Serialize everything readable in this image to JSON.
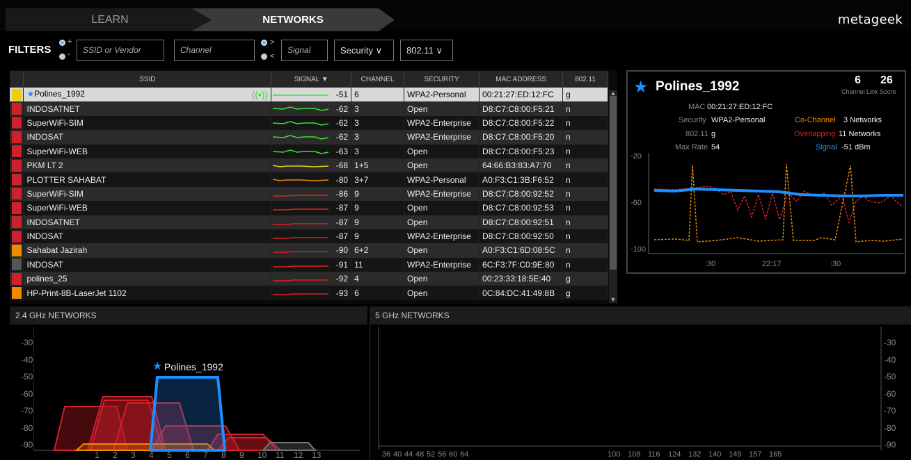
{
  "nav": {
    "learn": "LEARN",
    "networks": "NETWORKS",
    "brand": "metageek"
  },
  "filters": {
    "label": "FILTERS",
    "plus": "+",
    "minus": "-",
    "gt": ">",
    "lt": "<",
    "ssid_placeholder": "SSID or Vendor",
    "channel_placeholder": "Channel",
    "signal_placeholder": "Signal",
    "security": "Security ∨",
    "standard": "802.11 ∨"
  },
  "table": {
    "headers": [
      "SSID",
      "SIGNAL ▼",
      "CHANNEL",
      "SECURITY",
      "MAC ADDRESS",
      "802.11"
    ],
    "rows": [
      {
        "color": "#f0d000",
        "ssid": "Polines_1992",
        "signal": "-51",
        "channel": "6",
        "security": "WPA2-Personal",
        "mac": "00:21:27:ED:12:FC",
        "std": "g",
        "sigcolor": "#32e632"
      },
      {
        "color": "#d0202a",
        "ssid": "INDOSATNET",
        "signal": "-62",
        "channel": "3",
        "security": "Open",
        "mac": "D8:C7:C8:00:F5:21",
        "std": "n",
        "sigcolor": "#32e632"
      },
      {
        "color": "#d0202a",
        "ssid": "SuperWiFi-SIM",
        "signal": "-62",
        "channel": "3",
        "security": "WPA2-Enterprise",
        "mac": "D8:C7:C8:00:F5:22",
        "std": "n",
        "sigcolor": "#32e632"
      },
      {
        "color": "#d0202a",
        "ssid": "INDOSAT",
        "signal": "-62",
        "channel": "3",
        "security": "WPA2-Enterprise",
        "mac": "D8:C7:C8:00:F5:20",
        "std": "n",
        "sigcolor": "#32e632"
      },
      {
        "color": "#d0202a",
        "ssid": "SuperWiFi-WEB",
        "signal": "-63",
        "channel": "3",
        "security": "Open",
        "mac": "D8:C7:C8:00:F5:23",
        "std": "n",
        "sigcolor": "#32e632"
      },
      {
        "color": "#d0202a",
        "ssid": "PKM LT 2",
        "signal": "-68",
        "channel": "1+5",
        "security": "Open",
        "mac": "64:66:B3:83:A7:70",
        "std": "n",
        "sigcolor": "#e6d020"
      },
      {
        "color": "#d0202a",
        "ssid": "PLOTTER SAHABAT",
        "signal": "-80",
        "channel": "3+7",
        "security": "WPA2-Personal",
        "mac": "A0:F3:C1:3B:F6:52",
        "std": "n",
        "sigcolor": "#e68a10"
      },
      {
        "color": "#d0202a",
        "ssid": "SuperWiFi-SIM",
        "signal": "-86",
        "channel": "9",
        "security": "WPA2-Enterprise",
        "mac": "D8:C7:C8:00:92:52",
        "std": "n",
        "sigcolor": "#e02020"
      },
      {
        "color": "#d0202a",
        "ssid": "SuperWiFi-WEB",
        "signal": "-87",
        "channel": "9",
        "security": "Open",
        "mac": "D8:C7:C8:00:92:53",
        "std": "n",
        "sigcolor": "#e02020"
      },
      {
        "color": "#d0202a",
        "ssid": "INDOSATNET",
        "signal": "-87",
        "channel": "9",
        "security": "Open",
        "mac": "D8:C7:C8:00:92:51",
        "std": "n",
        "sigcolor": "#e02020"
      },
      {
        "color": "#d0202a",
        "ssid": "INDOSAT",
        "signal": "-87",
        "channel": "9",
        "security": "WPA2-Enterprise",
        "mac": "D8:C7:C8:00:92:50",
        "std": "n",
        "sigcolor": "#e02020"
      },
      {
        "color": "#f08a00",
        "ssid": "Sahabat Jazirah",
        "signal": "-90",
        "channel": "6+2",
        "security": "Open",
        "mac": "A0:F3:C1:6D:08:5C",
        "std": "n",
        "sigcolor": "#e02020"
      },
      {
        "color": "#555555",
        "ssid": "INDOSAT",
        "signal": "-91",
        "channel": "11",
        "security": "WPA2-Enterprise",
        "mac": "6C:F3:7F:C0:9E:80",
        "std": "n",
        "sigcolor": "#e02020"
      },
      {
        "color": "#d0202a",
        "ssid": "polines_25",
        "signal": "-92",
        "channel": "4",
        "security": "Open",
        "mac": "00:23:33:18:5E:40",
        "std": "g",
        "sigcolor": "#e02020"
      },
      {
        "color": "#f08a00",
        "ssid": "HP-Print-8B-LaserJet 1102",
        "signal": "-93",
        "channel": "6",
        "security": "Open",
        "mac": "0C:84:DC:41:49:8B",
        "std": "g",
        "sigcolor": "#e02020"
      }
    ]
  },
  "detail": {
    "ssid": "Polines_1992",
    "channel": "6",
    "channel_label": "Channel",
    "link_score": "26",
    "link_score_label": "Link Score",
    "mac_label": "MAC",
    "mac": "00:21:27:ED:12:FC",
    "security_label": "Security",
    "security": "WPA2-Personal",
    "std_label": "802.11",
    "std": "g",
    "maxrate_label": "Max Rate",
    "maxrate": "54",
    "cochannel_label": "Co-Channel",
    "cochannel": "3 Networks",
    "overlap_label": "Overlapping",
    "overlap": "11 Networks",
    "signal_label": "Signal",
    "signal": "-51 dBm",
    "y_ticks": [
      "-20",
      "-60",
      "-100"
    ],
    "x_ticks": [
      ":30",
      "22:17",
      ":30"
    ]
  },
  "panel24": {
    "title": "2.4 GHz NETWORKS",
    "y_ticks": [
      "-30",
      "-40",
      "-50",
      "-60",
      "-70",
      "-80",
      "-90"
    ],
    "x_ticks": [
      "1",
      "2",
      "3",
      "4",
      "5",
      "6",
      "7",
      "8",
      "9",
      "10",
      "11",
      "12",
      "13"
    ],
    "highlight": "Polines_1992"
  },
  "panel5": {
    "title": "5 GHz NETWORKS",
    "y_ticks": [
      "-30",
      "-40",
      "-50",
      "-60",
      "-70",
      "-80",
      "-90"
    ],
    "x_ticks_a": [
      "36",
      "40",
      "44",
      "48",
      "52",
      "56",
      "60",
      "64"
    ],
    "x_ticks_b": [
      "100",
      "108",
      "116",
      "124",
      "132",
      "140",
      "149",
      "157",
      "165"
    ]
  },
  "colors": {
    "accent": "#1e8fff",
    "selected_row": "#d8d8d8",
    "green": "#32e632",
    "red": "#e02020",
    "orange": "#f08a00"
  }
}
